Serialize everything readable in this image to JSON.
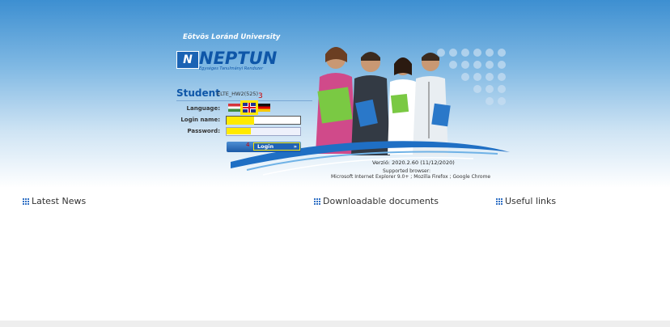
{
  "header": {
    "university": "Eötvös Loránd University",
    "logo_text": "NEPTUN",
    "logo_subtitle": "Egységes Tanulmányi Rendszer"
  },
  "login": {
    "title": "Student",
    "system": "ELTE_HW2(525)",
    "marker_3": "3",
    "marker_4": "4",
    "language_label": "Language:",
    "login_name_label": "Login name:",
    "password_label": "Password:",
    "login_name_value": "",
    "password_value": "",
    "login_button": "Login"
  },
  "languages": [
    {
      "name": "hungarian-flag-icon"
    },
    {
      "name": "english-flag-icon"
    },
    {
      "name": "german-flag-icon"
    }
  ],
  "info": {
    "version": "Verzió: 2020.2.60 (11/12/2020)",
    "supported": "Supported browser:",
    "browsers": "Microsoft Internet Explorer 9.0+ ; Mozilla Firefox ; Google Chrome"
  },
  "sections": {
    "news": "Latest News",
    "documents": "Downloadable documents",
    "links": "Useful links"
  },
  "colors": {
    "brand_blue": "#0e56a8",
    "highlight": "#ffea00",
    "marker_red": "#cc0000"
  }
}
